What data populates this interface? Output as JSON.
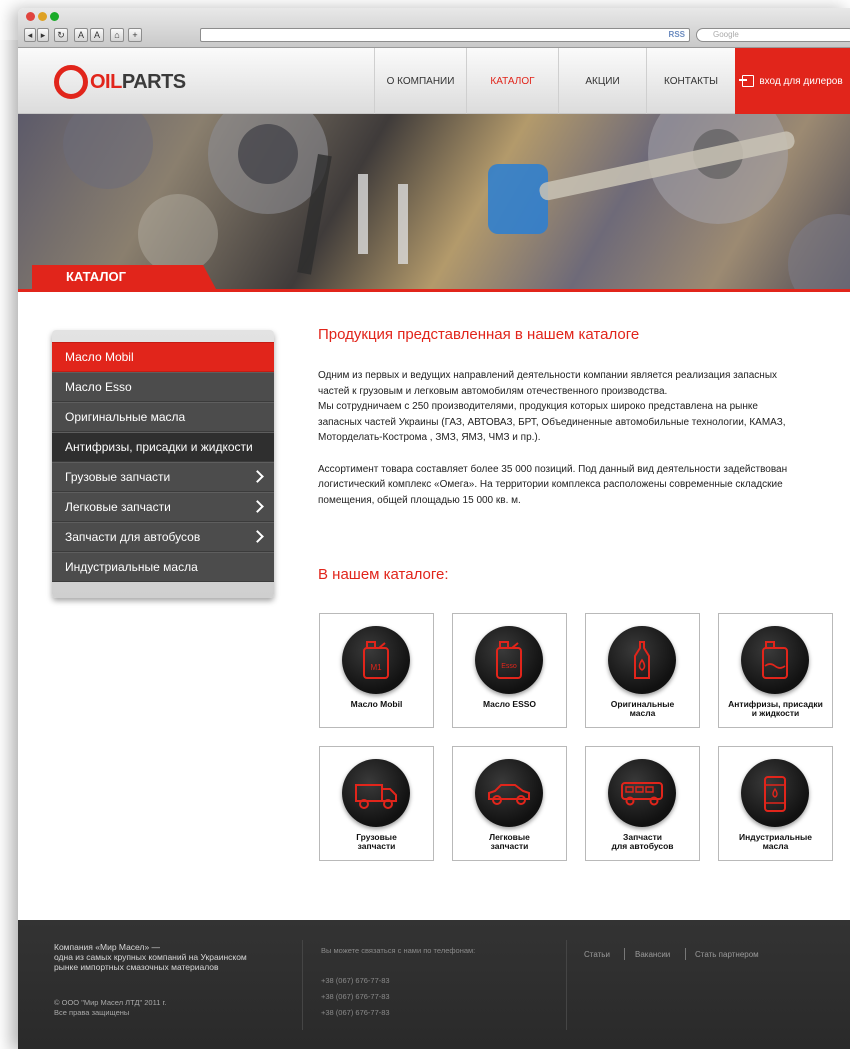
{
  "browser": {
    "toolbar_buttons": [
      "◂",
      "▸",
      "↻",
      "A",
      "A",
      "⌂",
      "+"
    ],
    "rss_label": "RSS",
    "search_placeholder": "Google"
  },
  "header": {
    "logo_part1": "OIL",
    "logo_part2": "PARTS",
    "nav": [
      "О КОМПАНИИ",
      "КАТАЛОГ",
      "АКЦИИ",
      "КОНТАКТЫ"
    ],
    "active_nav": 1,
    "dealer_button": "вход для дилеров"
  },
  "hero": {
    "badge": "КАТАЛОГ"
  },
  "sidebar": {
    "items": [
      {
        "label": "Масло Mobil",
        "has_arrow": false
      },
      {
        "label": "Масло Esso",
        "has_arrow": false
      },
      {
        "label": "Оригинальные масла",
        "has_arrow": false
      },
      {
        "label": "Антифризы, присадки и жидкости",
        "has_arrow": false
      },
      {
        "label": "Грузовые запчасти",
        "has_arrow": true
      },
      {
        "label": "Легковые запчасти",
        "has_arrow": true
      },
      {
        "label": "Запчасти для автобусов",
        "has_arrow": true
      },
      {
        "label": "Индустриальные масла",
        "has_arrow": false
      }
    ],
    "active_index": 0,
    "dark_index": 3
  },
  "content": {
    "title": "Продукция представленная в нашем каталоге",
    "para1": "Одним из первых и ведущих направлений деятельности компании является реализация запасных\nчастей к грузовым и легковым автомобилям отечественного производства.\nМы сотрудничаем с 250 производителями, продукция которых широко представлена на рынке\nзапасных частей Украины (ГАЗ, АВТОВАЗ, БРТ, Объединенные автомобильные технологии, КАМАЗ,\nМоторделать-Кострома , ЗМЗ, ЯМЗ, ЧМЗ и пр.).",
    "para2": "Ассортимент товара составляет более 35 000 позиций. Под данный вид деятельности задействован\nлогистический комплекс «Омега». На территории комплекса расположены современные складские\nпомещения, общей площадью 15 000 кв. м.",
    "catalog_title": "В нашем каталоге:"
  },
  "catalog": [
    {
      "label": "Масло Mobil",
      "icon": "oil-canister-mobil-icon",
      "icon_text": "M1"
    },
    {
      "label": "Масло ESSO",
      "icon": "oil-canister-esso-icon",
      "icon_text": "Esso"
    },
    {
      "label": "Оригинальные\nмасла",
      "icon": "oil-bottle-drop-icon",
      "icon_text": ""
    },
    {
      "label": "Антифризы, присадки\nи жидкости",
      "icon": "antifreeze-canister-icon",
      "icon_text": ""
    },
    {
      "label": "Грузовые\nзапчасти",
      "icon": "truck-icon",
      "icon_text": ""
    },
    {
      "label": "Легковые\nзапчасти",
      "icon": "car-icon",
      "icon_text": ""
    },
    {
      "label": "Запчасти\nдля автобусов",
      "icon": "bus-icon",
      "icon_text": ""
    },
    {
      "label": "Индустриальные\nмасла",
      "icon": "oil-barrel-icon",
      "icon_text": ""
    }
  ],
  "footer": {
    "company": "Компания «Мир Масел» —\nодна из самых крупных компаний на Украинском\nрынке импортных смазочных материалов",
    "copyright": "© ООО \"Мир Масел ЛТД\" 2011 г.\nВсе права защищены",
    "phones_title": "Вы можете связаться с нами по телефонам:",
    "phones": [
      "+38 (067) 676-77-83",
      "+38 (067) 676-77-83",
      "+38 (067) 676-77-83"
    ],
    "links": [
      "Статьи",
      "Вакансии",
      "Стать партнером"
    ]
  },
  "colors": {
    "accent": "#e1251b",
    "menu_bg": "#4c4c4c",
    "footer_bg": "#2f2f2f"
  }
}
